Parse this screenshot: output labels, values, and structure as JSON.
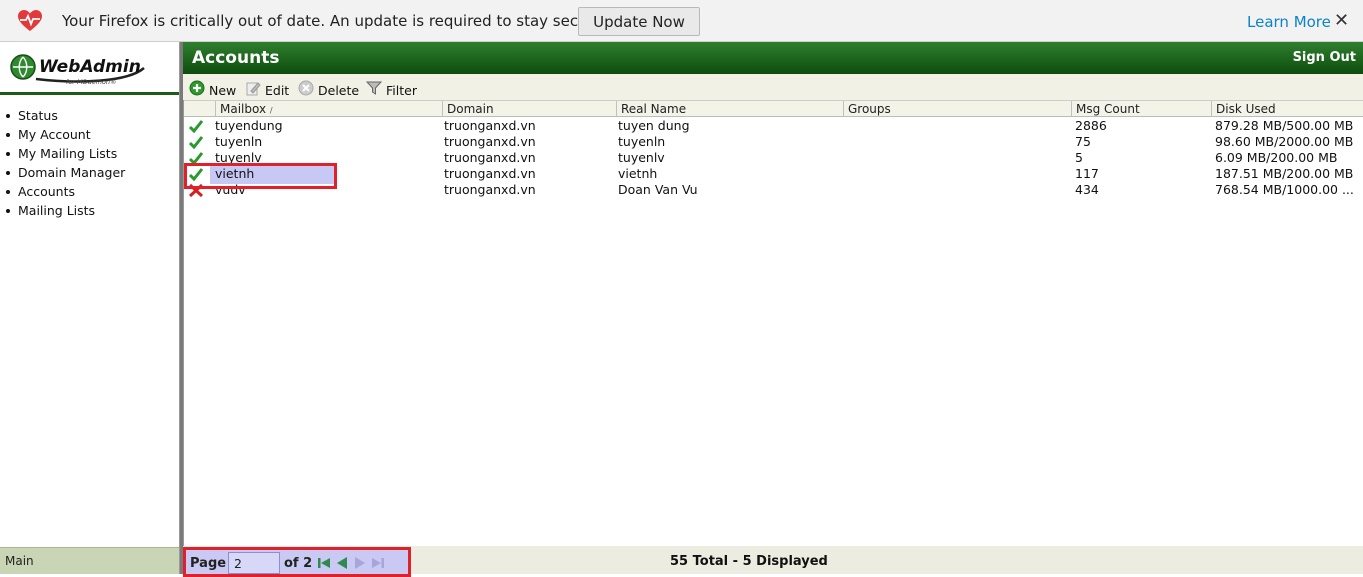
{
  "notification": {
    "message": "Your Firefox is critically out of date. An update is required to stay secure.",
    "update_label": "Update Now",
    "learn_more": "Learn More",
    "close": "✕"
  },
  "sidebar": {
    "logo_text": "WebAdmin",
    "logo_subtext": "for MDaemon®",
    "items": [
      {
        "label": "Status"
      },
      {
        "label": "My Account"
      },
      {
        "label": "My Mailing Lists"
      },
      {
        "label": "Domain Manager"
      },
      {
        "label": "Accounts"
      },
      {
        "label": "Mailing Lists"
      }
    ],
    "footer": "Main"
  },
  "header": {
    "title": "Accounts",
    "signout": "Sign Out"
  },
  "toolbar": {
    "new": "New",
    "edit": "Edit",
    "delete": "Delete",
    "filter": "Filter"
  },
  "grid": {
    "columns": [
      "Mailbox",
      "Domain",
      "Real Name",
      "Groups",
      "Msg Count",
      "Disk Used"
    ],
    "sort_indicator": "/",
    "rows": [
      {
        "status": "enabled",
        "mailbox": "tuyendung",
        "domain": "truonganxd.vn",
        "real_name": "tuyen dung",
        "groups": "",
        "msg_count": "2886",
        "disk_used": "879.28 MB/500.00 MB"
      },
      {
        "status": "enabled",
        "mailbox": "tuyenln",
        "domain": "truonganxd.vn",
        "real_name": "tuyenln",
        "groups": "",
        "msg_count": "75",
        "disk_used": "98.60 MB/2000.00 MB"
      },
      {
        "status": "enabled",
        "mailbox": "tuyenlv",
        "domain": "truonganxd.vn",
        "real_name": "tuyenlv",
        "groups": "",
        "msg_count": "5",
        "disk_used": "6.09 MB/200.00 MB"
      },
      {
        "status": "enabled",
        "mailbox": "vietnh",
        "domain": "truonganxd.vn",
        "real_name": "vietnh",
        "groups": "",
        "msg_count": "117",
        "disk_used": "187.51 MB/200.00 MB"
      },
      {
        "status": "disabled",
        "mailbox": "vudv",
        "domain": "truonganxd.vn",
        "real_name": "Doan Van Vu",
        "groups": "",
        "msg_count": "434",
        "disk_used": "768.54 MB/1000.00 ..."
      }
    ]
  },
  "footer": {
    "page_label": "Page",
    "page_value": "2",
    "of_label": "of 2",
    "total": "55 Total - 5 Displayed"
  },
  "colors": {
    "header_green": "#1a5e1a",
    "highlight_red": "#e0202a",
    "selection": "#c8c8f4"
  }
}
